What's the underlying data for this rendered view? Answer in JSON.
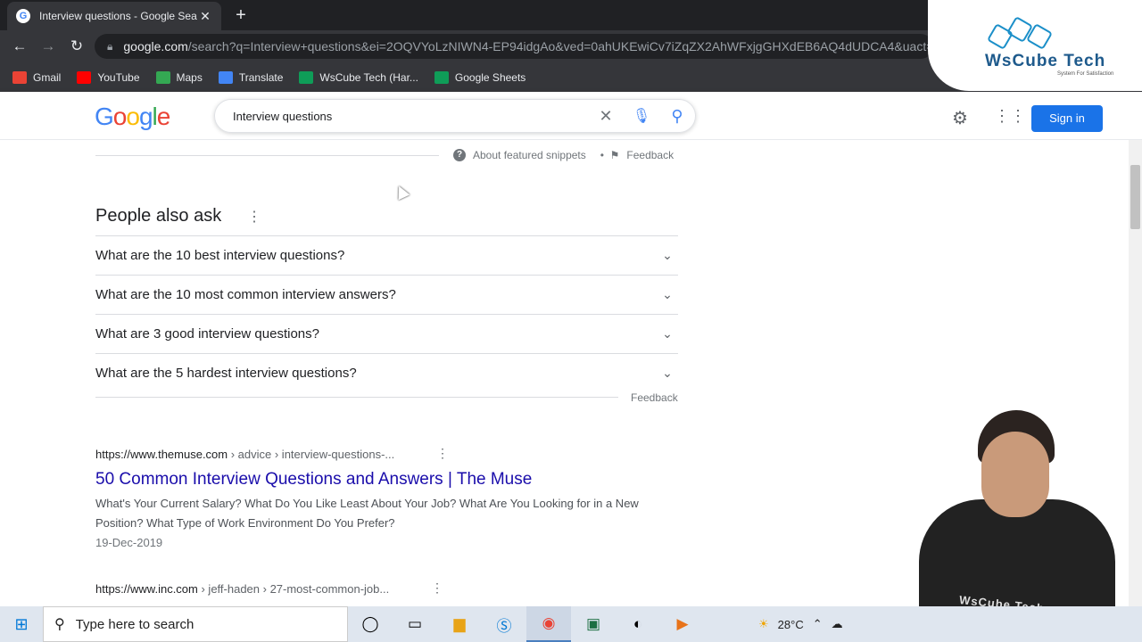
{
  "browser": {
    "tab_title": "Interview questions - Google Sea",
    "url_domain": "google.com",
    "url_path": "/search?q=Interview+questions&ei=2OQVYoLzNIWN4-EP94idgAo&ved=0ahUKEwiCv7iZqZX2AhWFxjgGHXdEB6AQ4dUDCA4&uact=",
    "bookmarks": [
      {
        "label": "Gmail",
        "color": "#ea4335"
      },
      {
        "label": "YouTube",
        "color": "#ff0000"
      },
      {
        "label": "Maps",
        "color": "#34a853"
      },
      {
        "label": "Translate",
        "color": "#4285f4"
      },
      {
        "label": "WsCube Tech (Har...",
        "color": "#0f9d58"
      },
      {
        "label": "Google Sheets",
        "color": "#0f9d58"
      }
    ]
  },
  "overlay": {
    "brand": "WsCube Tech",
    "tagline": "System For Satisfaction",
    "shirt_logo": "WsCube Tech"
  },
  "header": {
    "logo": "Google",
    "query": "Interview questions",
    "signin": "Sign in"
  },
  "snippet_bar": {
    "about": "About featured snippets",
    "feedback": "Feedback"
  },
  "paa": {
    "title": "People also ask",
    "questions": [
      "What are the 10 best interview questions?",
      "What are the 10 most common interview answers?",
      "What are 3 good interview questions?",
      "What are the 5 hardest interview questions?"
    ],
    "feedback": "Feedback"
  },
  "results": [
    {
      "domain": "https://www.themuse.com",
      "path": " › advice › interview-questions-...",
      "title": "50 Common Interview Questions and Answers | The Muse",
      "snippet": "What's Your Current Salary? What Do You Like Least About Your Job? What Are You Looking for in a New Position? What Type of Work Environment Do You Prefer?",
      "date": "19-Dec-2019"
    },
    {
      "domain": "https://www.inc.com",
      "path": " › jeff-haden › 27-most-common-job..."
    }
  ],
  "taskbar": {
    "search_placeholder": "Type here to search",
    "temperature": "28°C"
  }
}
